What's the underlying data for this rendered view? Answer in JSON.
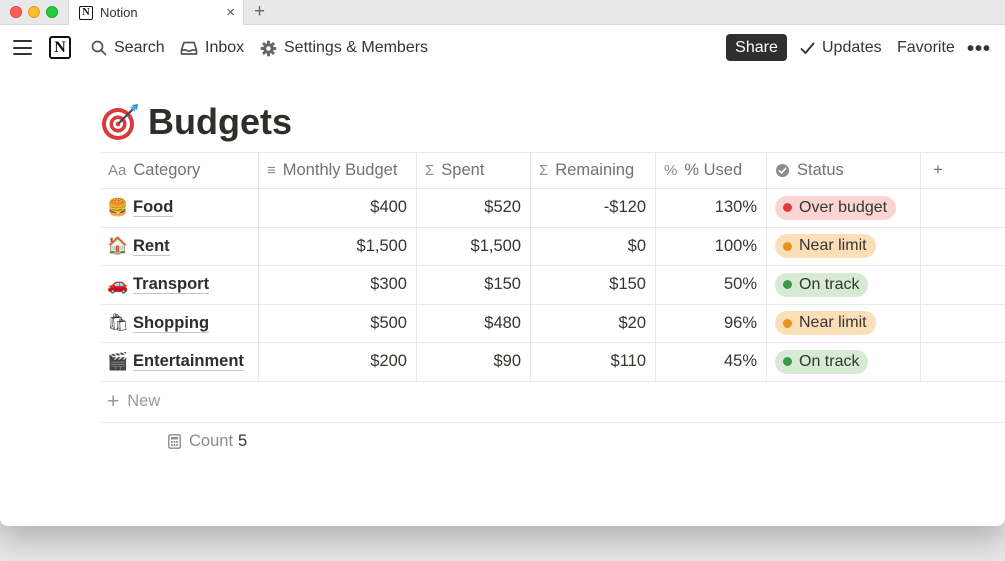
{
  "browser": {
    "tab_title": "Notion",
    "tab_logo": "N",
    "close_glyph": "×",
    "new_tab_glyph": "+"
  },
  "toolbar": {
    "logo": "N",
    "search_label": "Search",
    "inbox_label": "Inbox",
    "settings_label": "Settings & Members",
    "share_label": "Share",
    "updates_label": "Updates",
    "favorite_label": "Favorite",
    "more_glyph": "•••"
  },
  "page": {
    "title": "Budgets",
    "icon": "target-dart-icon"
  },
  "table": {
    "columns": [
      {
        "label": "Category",
        "icon": "Aa"
      },
      {
        "label": "Monthly Budget",
        "icon": "≡"
      },
      {
        "label": "Spent",
        "icon": "Σ"
      },
      {
        "label": "Remaining",
        "icon": "Σ"
      },
      {
        "label": "% Used",
        "icon": "%"
      },
      {
        "label": "Status",
        "icon": "status-check-icon"
      }
    ],
    "add_column_glyph": "+",
    "rows": [
      {
        "emoji": "🍔",
        "category": "Food",
        "budget": "$400",
        "spent": "$520",
        "remaining": "-$120",
        "used": "130%",
        "status": "Over budget",
        "status_color": "#e03e3e"
      },
      {
        "emoji": "🏠",
        "category": "Rent",
        "budget": "$1,500",
        "spent": "$1,500",
        "remaining": "$0",
        "used": "100%",
        "status": "Near limit",
        "status_color": "#e8911d"
      },
      {
        "emoji": "🚗",
        "category": "Transport",
        "budget": "$300",
        "spent": "$150",
        "remaining": "$150",
        "used": "50%",
        "status": "On track",
        "status_color": "#3a9b4b"
      },
      {
        "emoji": "🛍",
        "category": "Shopping",
        "budget": "$500",
        "spent": "$480",
        "remaining": "$20",
        "used": "96%",
        "status": "Near limit",
        "status_color": "#e8911d"
      },
      {
        "emoji": "🎬",
        "category": "Entertainment",
        "budget": "$200",
        "spent": "$90",
        "remaining": "$110",
        "used": "45%",
        "status": "On track",
        "status_color": "#3a9b4b"
      }
    ],
    "new_row_glyph": "+",
    "new_row_label": "New",
    "count_label": "Count",
    "count_value": "5"
  }
}
